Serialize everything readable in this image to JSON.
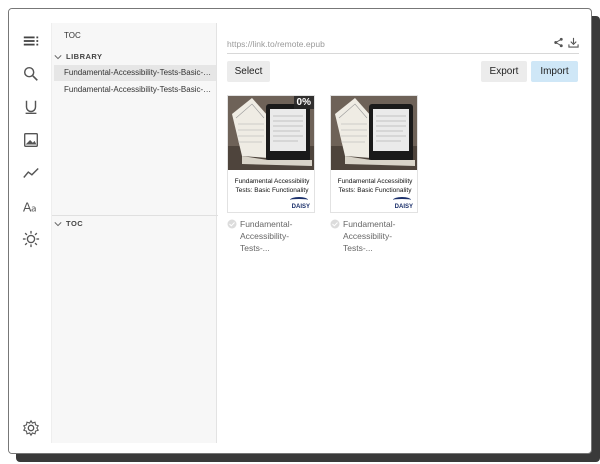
{
  "sidebar": {
    "title": "TOC",
    "library_header": "LIBRARY",
    "library_items": [
      {
        "label": "Fundamental-Accessibility-Tests-Basic-Functionality"
      },
      {
        "label": "Fundamental-Accessibility-Tests-Basic-Functionality"
      }
    ],
    "toc_header": "TOC"
  },
  "rail": {
    "icons": [
      "menu-icon",
      "search-icon",
      "underline-icon",
      "image-icon",
      "trend-icon",
      "font-icon",
      "brightness-icon",
      "settings-icon"
    ]
  },
  "toolbar": {
    "url_placeholder": "https://link.to/remote.epub",
    "select_label": "Select",
    "export_label": "Export",
    "import_label": "Import"
  },
  "books": [
    {
      "cover_title": "Fundamental Accessibility Tests: Basic Functionality",
      "caption_line1": "Fundamental-",
      "caption_line2": "Accessibility-Tests-...",
      "progress": "0%",
      "publisher": "DAISY"
    },
    {
      "cover_title": "Fundamental Accessibility Tests: Basic Functionality",
      "caption_line1": "Fundamental-",
      "caption_line2": "Accessibility-Tests-...",
      "publisher": "DAISY"
    }
  ],
  "colors": {
    "import_bg": "#cfe7f7",
    "button_bg": "#ececec",
    "sidebar_bg": "#f7f7f7"
  }
}
